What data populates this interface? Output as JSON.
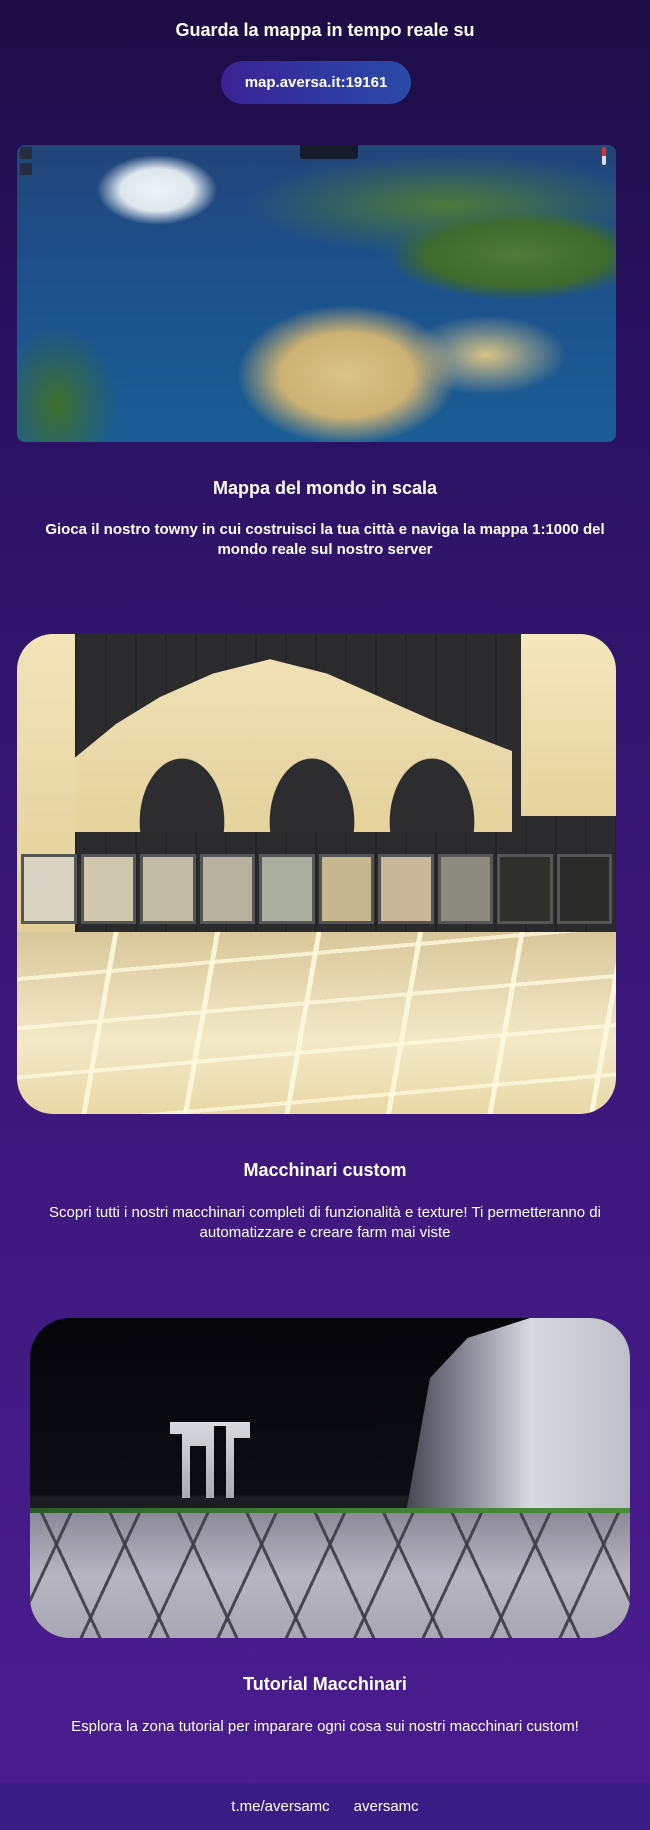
{
  "hero": {
    "title": "Guarda la mappa in tempo reale su",
    "map_link": "map.aversa.it:19161"
  },
  "sections": [
    {
      "title": "Mappa del mondo in scala",
      "description": "Gioca il nostro towny in cui costruisci la tua città e naviga la mappa 1:1000 del mondo reale sul nostro server"
    },
    {
      "title": "Macchinari custom",
      "description": "Scopri tutti i nostri macchinari completi di funzionalità e texture! Ti permetteranno di automatizzare e creare farm mai viste"
    },
    {
      "title": "Tutorial Macchinari",
      "description": "Esplora la zona tutorial per imparare ogni cosa sui nostri macchinari custom!"
    }
  ],
  "footer": {
    "links": [
      "t.me/aversamc",
      "aversamc"
    ]
  }
}
